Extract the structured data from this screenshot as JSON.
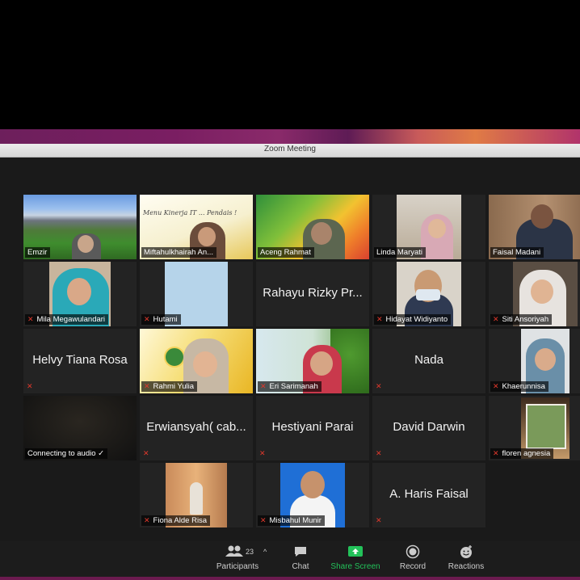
{
  "window": {
    "title": "Zoom Meeting"
  },
  "tiles": {
    "t1": {
      "name": "Emzir"
    },
    "t2": {
      "name": "Miftahulkhairah An...",
      "slide_text": "Menu Kinerja IT ... Pendais !"
    },
    "t3": {
      "name": "Aceng Rahmat"
    },
    "t4": {
      "name": "Linda Maryati"
    },
    "t5": {
      "name": "Faisal Madani"
    },
    "t6": {
      "name": "Mila Megawulandari"
    },
    "t7": {
      "name": "Hutami"
    },
    "t8": {
      "display": "Rahayu Rizky Pr..."
    },
    "t9": {
      "name": "Hidayat Widiyanto"
    },
    "t10": {
      "name": "Siti Ansoriyah"
    },
    "t11": {
      "display": "Helvy Tiana Rosa"
    },
    "t12": {
      "name": "Rahmi Yulia"
    },
    "t13": {
      "name": "Eri Sarimanah"
    },
    "t14": {
      "display": "Nada"
    },
    "t15": {
      "name": "Khaerunnisa"
    },
    "t16": {
      "name": "Connecting to audio"
    },
    "t17": {
      "display": "Erwiansyah( cab..."
    },
    "t18": {
      "display": "Hestiyani Parai"
    },
    "t19": {
      "display": "David Darwin"
    },
    "t20": {
      "name": "floren agnesia"
    },
    "t21": {
      "name": "Fiona Alde Risa"
    },
    "t22": {
      "name": "Misbahul Munir"
    },
    "t23": {
      "display": "A. Haris Faisal"
    }
  },
  "toolbar": {
    "participants_label": "Participants",
    "participants_count": "23",
    "chat_label": "Chat",
    "share_label": "Share Screen",
    "record_label": "Record",
    "reactions_label": "Reactions"
  },
  "colors": {
    "accent_green": "#23c25a",
    "active_speaker": "#c9d93a",
    "muted_red": "#e0382c"
  }
}
